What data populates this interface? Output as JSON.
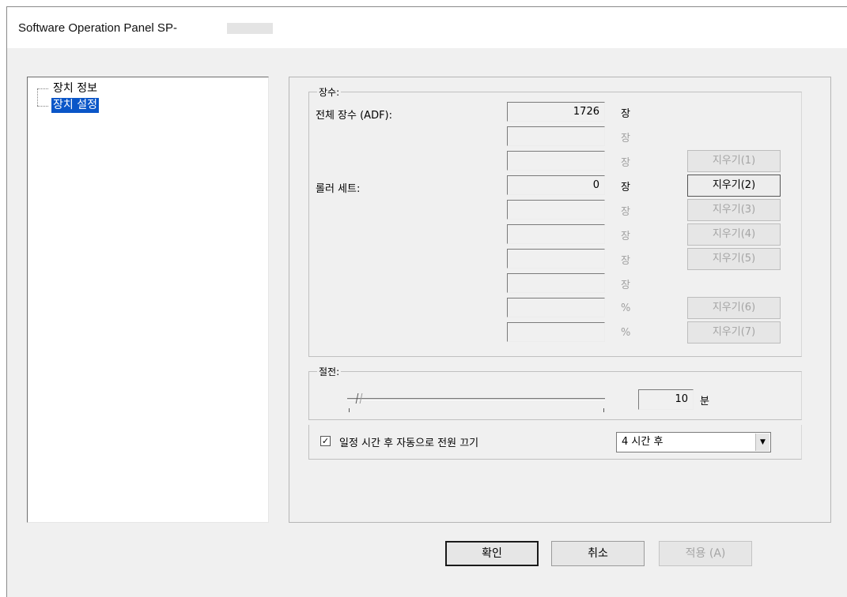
{
  "window": {
    "title": "Software Operation Panel SP-"
  },
  "tree": {
    "items": [
      {
        "label": "장치 정보",
        "selected": false
      },
      {
        "label": "장치 설정",
        "selected": true
      }
    ]
  },
  "count_group": {
    "label": "장수:",
    "total_label": "전체 장수 (ADF):",
    "roller_label": "롤러 세트:",
    "rows": [
      {
        "value": "1726",
        "unit": "장"
      },
      {
        "value": "",
        "unit": "장"
      },
      {
        "value": "",
        "unit": "장"
      },
      {
        "value": "0",
        "unit": "장"
      },
      {
        "value": "",
        "unit": "장"
      },
      {
        "value": "",
        "unit": "장"
      },
      {
        "value": "",
        "unit": "장"
      },
      {
        "value": "",
        "unit": "장"
      },
      {
        "value": "",
        "unit": "%"
      },
      {
        "value": "",
        "unit": "%"
      }
    ],
    "clear_buttons": [
      "지우기(1)",
      "지우기(2)",
      "지우기(3)",
      "지우기(4)",
      "지우기(5)",
      "지우기(6)",
      "지우기(7)"
    ]
  },
  "power_group": {
    "label": "절전:",
    "value": "10",
    "unit": "분",
    "slider_fraction": 0.04
  },
  "auto_power_off": {
    "checked": true,
    "check_mark": "✓",
    "label": "일정 시간 후 자동으로 전원 끄기",
    "selected_option": "4 시간 후",
    "arrow": "▼"
  },
  "footer": {
    "ok_label": "확인",
    "cancel_label": "취소",
    "apply_label": "적용 (A)"
  }
}
